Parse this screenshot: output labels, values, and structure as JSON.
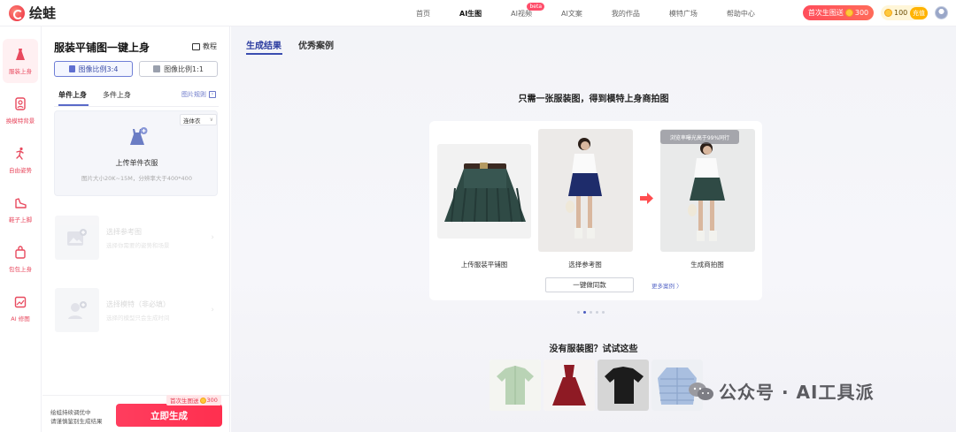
{
  "app": {
    "name": "绘蛙"
  },
  "nav": {
    "items": [
      {
        "label": "首页",
        "active": false
      },
      {
        "label": "AI生图",
        "active": true
      },
      {
        "label": "AI视频",
        "active": false,
        "badge": "beta"
      },
      {
        "label": "AI文案",
        "active": false
      },
      {
        "label": "我的作品",
        "active": false
      },
      {
        "label": "模特广场",
        "active": false
      },
      {
        "label": "帮助中心",
        "active": false
      }
    ],
    "promo": {
      "text": "首次生图送",
      "amount": "300"
    },
    "points": {
      "value": "100",
      "recharge_label": "充值"
    }
  },
  "sidebar": {
    "items": [
      {
        "label": "服装上身",
        "active": true
      },
      {
        "label": "换模特背景",
        "active": false
      },
      {
        "label": "自由姿势",
        "active": false
      },
      {
        "label": "鞋子上脚",
        "active": false
      },
      {
        "label": "包包上身",
        "active": false
      },
      {
        "label": "AI 修图",
        "active": false
      }
    ]
  },
  "panel": {
    "title": "服装平铺图一键上身",
    "tutorial_label": "教程",
    "ratios": [
      {
        "label": "图像比例3:4",
        "active": true
      },
      {
        "label": "图像比例1:1",
        "active": false
      }
    ],
    "tabs": [
      {
        "label": "单件上身",
        "active": true
      },
      {
        "label": "多件上身",
        "active": false
      }
    ],
    "rules_label": "图片规则",
    "upload": {
      "garment_type": "连体衣",
      "title": "上传单件衣服",
      "hint": "图片大小20K~15M，分辨率大于400*400"
    },
    "reference": {
      "title": "选择参考图",
      "sub": "选择你需要的姿势和场景"
    },
    "model": {
      "title": "选择模特（非必填）",
      "sub": "选择的模型只会生成时间"
    },
    "footer": {
      "hint_line1": "绘蛙持续调优中",
      "hint_line2": "请谨慎鉴别生成结果",
      "generate_label": "立即生成",
      "badge_text": "首次生图送",
      "badge_amount": "300"
    }
  },
  "main": {
    "tabs": [
      {
        "label": "生成结果",
        "active": true
      },
      {
        "label": "优秀案例",
        "active": false
      }
    ],
    "headline": "只需一张服装图，得到模特上身商拍图",
    "demo": {
      "captions": [
        "上传服装平铺图",
        "选择参考图",
        "生成商拍图"
      ],
      "exposure_tag": "浏览率曝光高于99%同行",
      "same_button": "一键做同款",
      "more_link": "更多案例 〉"
    },
    "carousel": {
      "count": 5,
      "active_index": 1
    },
    "sub_headline": "没有服装图？试试这些",
    "samples": [
      "green-shirt",
      "red-dress",
      "black-tshirt",
      "blue-puffer-jacket"
    ]
  },
  "watermark": {
    "text": "公众号 · AI工具派"
  },
  "colors": {
    "brand_red": "#ff3d5e",
    "accent_blue": "#3a4db0",
    "sidebar_active_bg": "#fff0f2",
    "main_bg": "#f3f4f8"
  }
}
